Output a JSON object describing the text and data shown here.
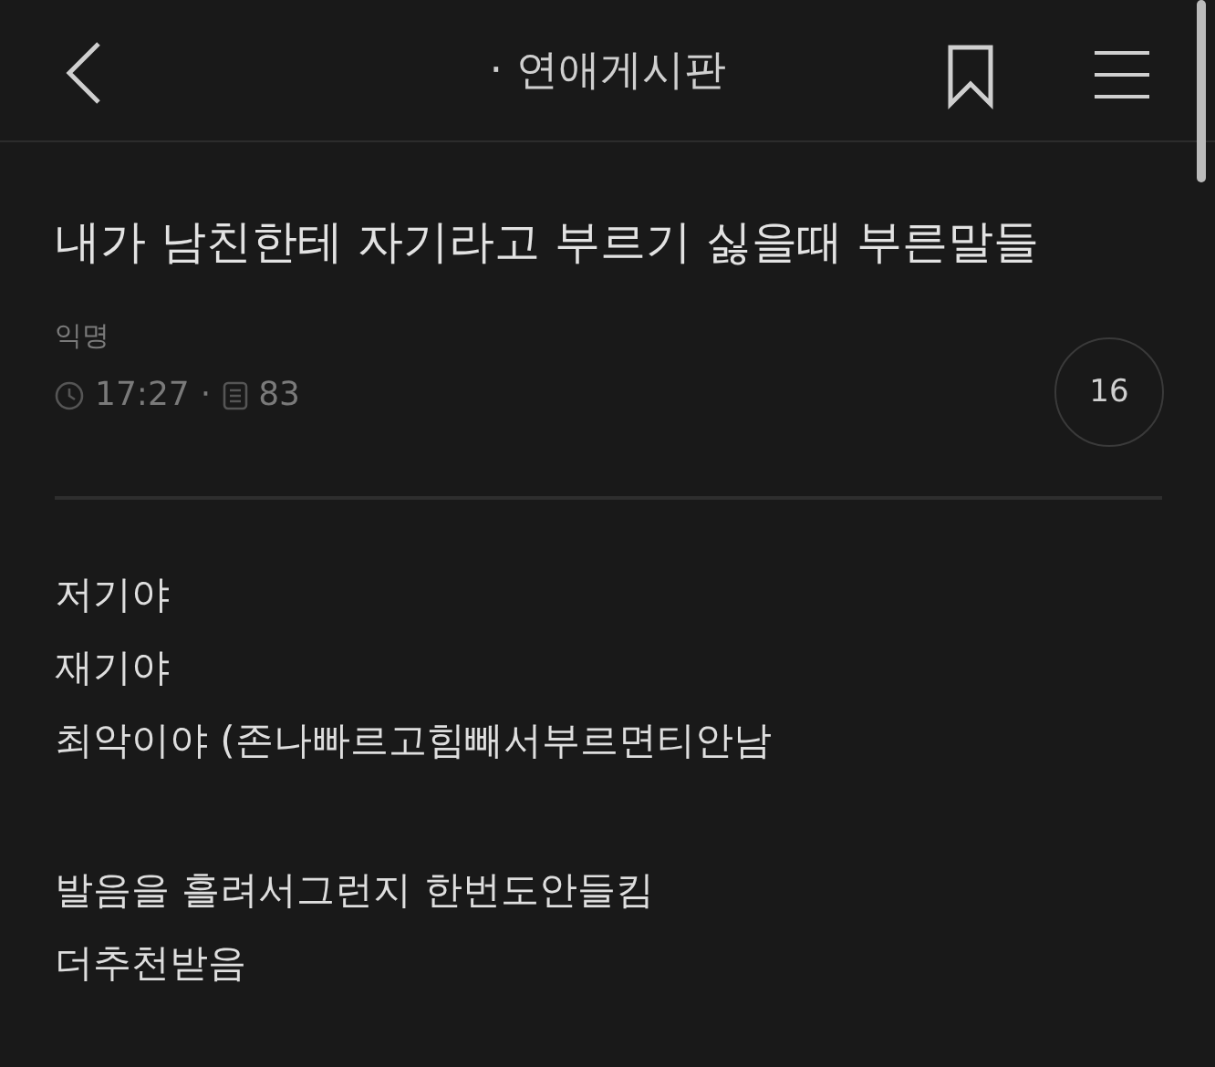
{
  "header": {
    "board_title": "· 연애게시판"
  },
  "post": {
    "title": "내가 남친한테 자기라고 부르기 싫을때 부른말들",
    "author": "익명",
    "time": "17:27",
    "separator": "·",
    "views": "83",
    "comment_count": "16",
    "paragraphs": [
      [
        "저기야",
        "재기야",
        "최악이야 (존나빠르고힘빼서부르면티안남"
      ],
      [
        "발음을 흘려서그런지 한번도안들킴",
        "더추천받음"
      ]
    ]
  }
}
